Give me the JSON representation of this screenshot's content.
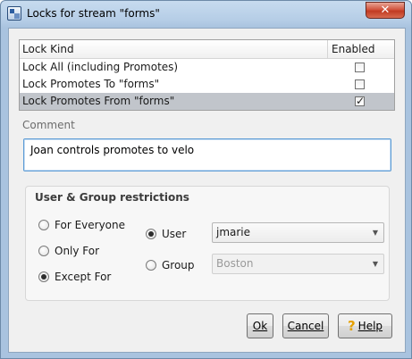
{
  "window": {
    "title": "Locks for stream \"forms\"",
    "close_glyph": "✕"
  },
  "lock_table": {
    "columns": [
      "Lock Kind",
      "Enabled"
    ],
    "rows": [
      {
        "kind": "Lock All (including Promotes)",
        "enabled": false,
        "selected": false
      },
      {
        "kind": "Lock Promotes To \"forms\"",
        "enabled": false,
        "selected": false
      },
      {
        "kind": "Lock Promotes From \"forms\"",
        "enabled": true,
        "selected": true
      }
    ]
  },
  "comment": {
    "label": "Comment",
    "value": "Joan controls promotes to velo"
  },
  "restrictions": {
    "title": "User & Group restrictions",
    "scope_options": [
      {
        "label": "For Everyone",
        "selected": false
      },
      {
        "label": "Only For",
        "selected": false
      },
      {
        "label": "Except For",
        "selected": true
      }
    ],
    "principal_options": [
      {
        "label": "User",
        "selected": true,
        "value": "jmarie",
        "enabled": true
      },
      {
        "label": "Group",
        "selected": false,
        "value": "Boston",
        "enabled": false
      }
    ]
  },
  "buttons": {
    "ok": "Ok",
    "cancel": "Cancel",
    "help": "Help"
  },
  "colors": {
    "title_gradient": "#b5cde6",
    "selected_row": "#c1c5cb",
    "close_button": "#c13a22",
    "focus_border": "#5b9bd5"
  }
}
